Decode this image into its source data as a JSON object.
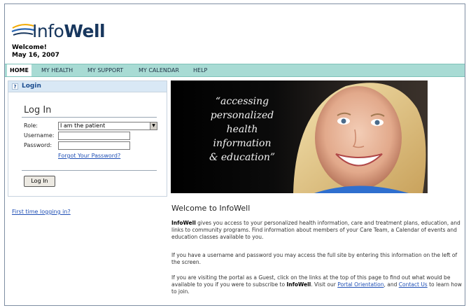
{
  "brand": {
    "name_light": "Info",
    "name_bold": "Well"
  },
  "header": {
    "welcome": "Welcome!",
    "date": "May 16, 2007"
  },
  "nav": {
    "items": [
      "HOME",
      "MY HEALTH",
      "MY SUPPORT",
      "MY CALENDAR",
      "HELP"
    ],
    "active": "HOME"
  },
  "login": {
    "header_label": "Login",
    "title": "Log In",
    "role_label": "Role:",
    "role_value": "I am the patient",
    "username_label": "Username:",
    "username_value": "",
    "password_label": "Password:",
    "password_value": "",
    "forgot_link": "Forgot Your Password?",
    "button": "Log In"
  },
  "first_time_link": "First time logging in?",
  "hero": {
    "quote_lines": [
      "“accessing",
      "personalized",
      "health",
      "information",
      "& education”"
    ]
  },
  "content": {
    "title": "Welcome to InfoWell",
    "p1_brand": "InfoWell",
    "p1": " gives you access to your personalized health information, care and treatment plans, education, and links to community programs. Find information about members of your Care Team, a Calendar of events and education classes available to you.",
    "p2": "If you have a username and password you may access the full site by entering this information on the left of the screen.",
    "p3_a": "If you are visiting the portal as a Guest, click on the links at the top of this page to find out what would be available to you if you were to subscribe to ",
    "p3_brand": "InfoWell",
    "p3_b": ". Visit our ",
    "p3_link1": "Portal Orientation",
    "p3_c": ", and ",
    "p3_link2": "Contact Us",
    "p3_d": " to learn how to join."
  },
  "colors": {
    "nav_bg": "#a8dbd4",
    "brand_navy": "#17365d",
    "link": "#1f4fb5",
    "login_header_bg": "#d9e8f5"
  },
  "icons": {
    "help": "question-mark",
    "logo": "swoosh-lines"
  }
}
